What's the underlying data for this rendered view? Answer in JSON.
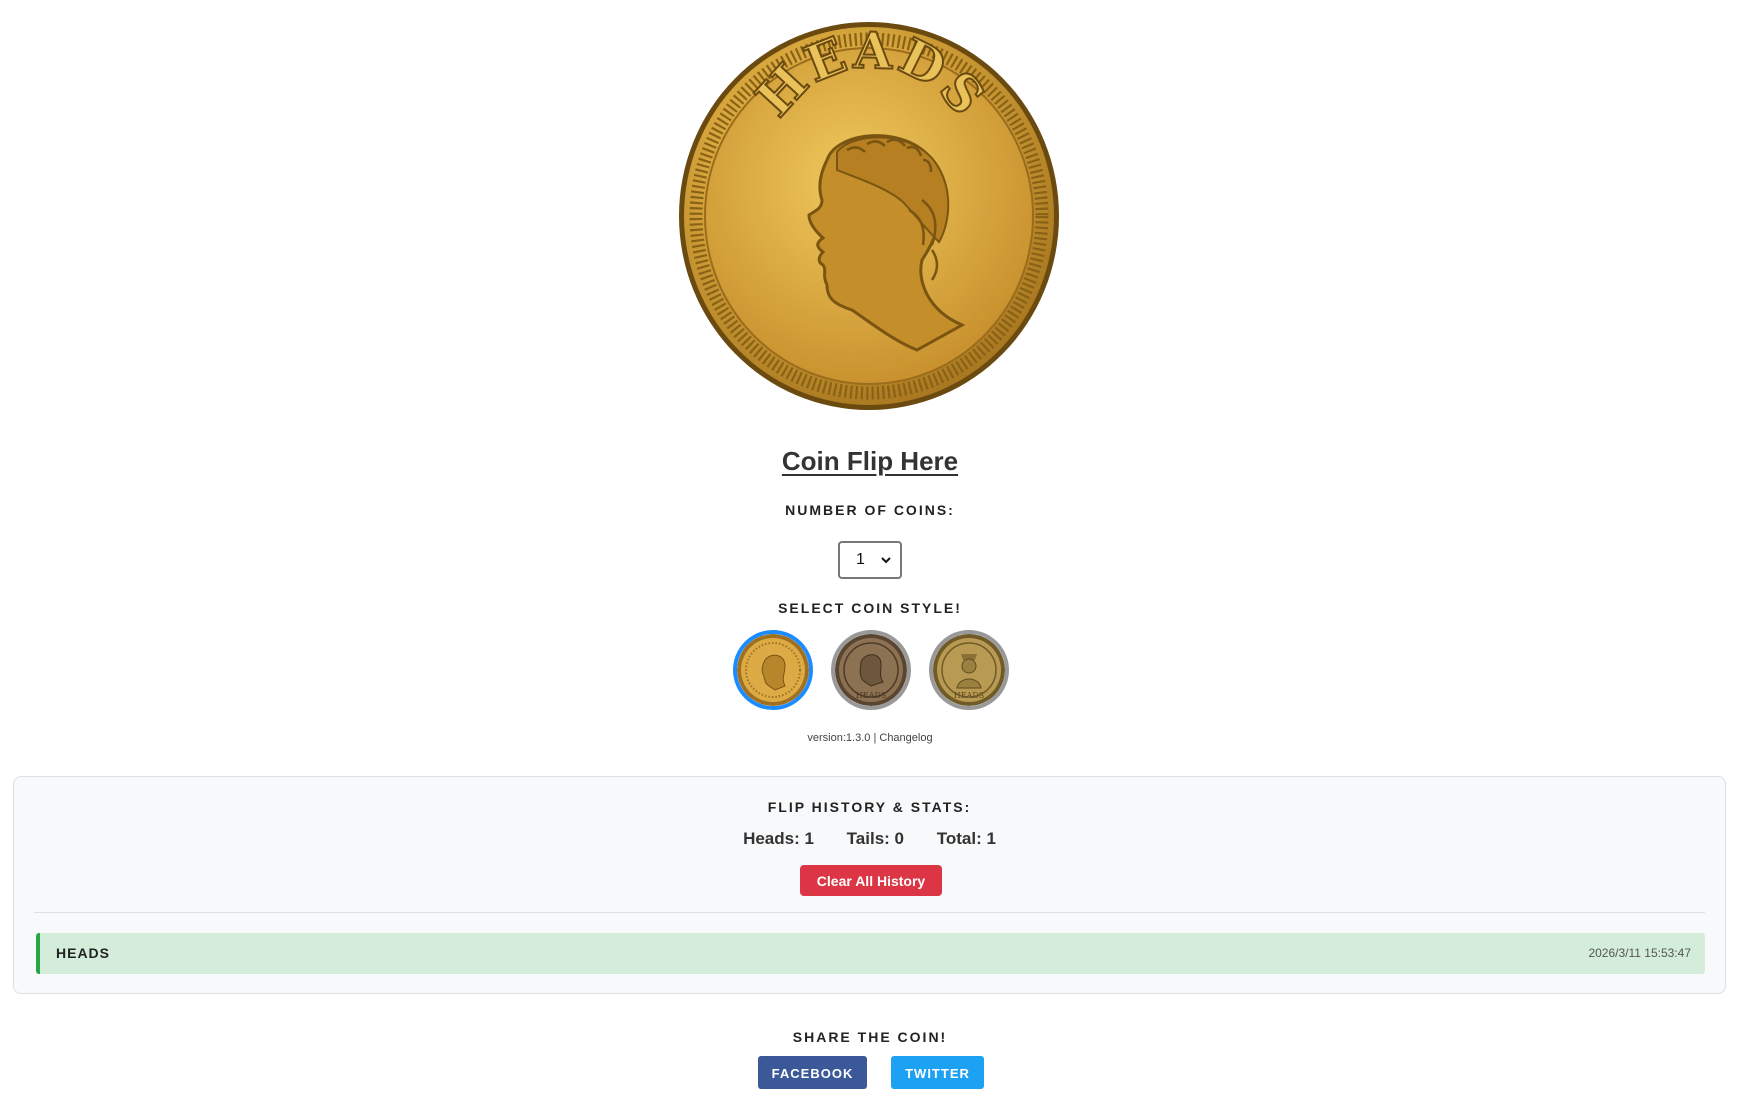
{
  "main_coin": {
    "face_text": "HEADS",
    "colors": {
      "gold": "#d4a43a",
      "gold_dark": "#8a6216",
      "rim": "#6b4a10"
    }
  },
  "title": "Coin Flip Here",
  "number_of_coins": {
    "label": "NUMBER OF COINS:",
    "selected": "1"
  },
  "coin_style": {
    "label": "SELECT COIN STYLE!",
    "options": [
      {
        "name": "gold",
        "selected": true
      },
      {
        "name": "bronze",
        "selected": false,
        "text": "HEADS"
      },
      {
        "name": "brass",
        "selected": false,
        "text": "HEADS"
      }
    ],
    "selected_border_color": "#1a8cff"
  },
  "version": {
    "text": "version:1.3.0",
    "separator": "|",
    "changelog": "Changelog"
  },
  "history": {
    "title": "FLIP HISTORY & STATS:",
    "stats": {
      "heads": "Heads: 1",
      "tails": "Tails: 0",
      "total": "Total: 1"
    },
    "clear_label": "Clear All History",
    "entries": [
      {
        "result": "HEADS",
        "timestamp": "2026/3/11 15:53:47"
      }
    ]
  },
  "share": {
    "label": "SHARE THE COIN!",
    "facebook": "FACEBOOK",
    "twitter": "TWITTER"
  }
}
